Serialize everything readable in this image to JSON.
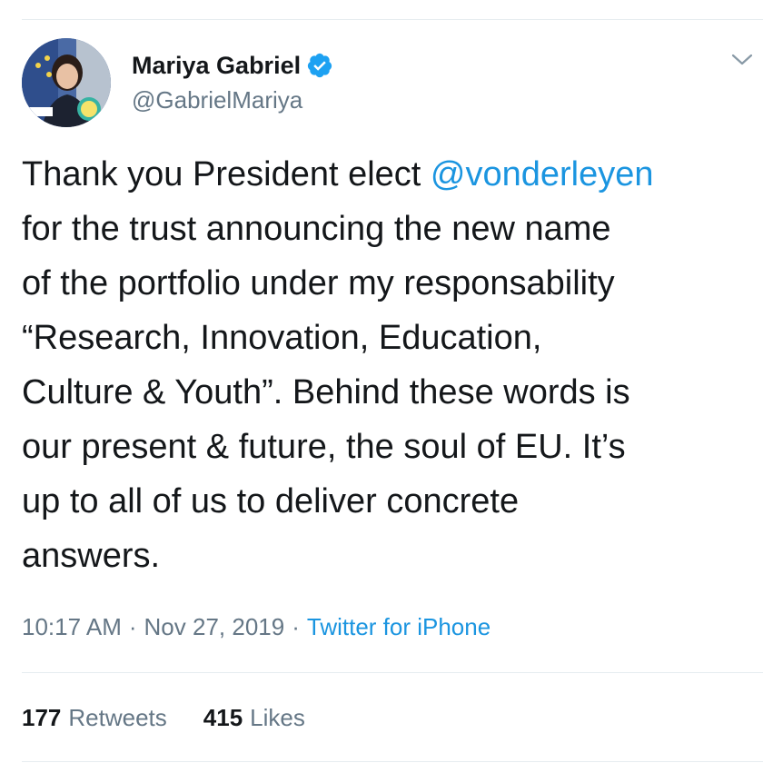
{
  "author": {
    "name": "Mariya Gabriel",
    "handle": "@GabrielMariya",
    "verified": true
  },
  "tweet": {
    "text_before": "Thank you President elect ",
    "mention": "@vonderleyen",
    "text_after": "\nfor the trust announcing the new name\nof the portfolio under my responsability\n“Research, Innovation, Education,\nCulture & Youth”. Behind these words is\nour present & future, the soul of EU. It’s\nup to all of us to deliver concrete\nanswers."
  },
  "meta": {
    "time": "10:17 AM",
    "date": "Nov 27, 2019",
    "separator": "·",
    "source": "Twitter for iPhone"
  },
  "stats": {
    "retweets_count": "177",
    "retweets_label": "Retweets",
    "likes_count": "415",
    "likes_label": "Likes"
  },
  "colors": {
    "link": "#1b95e0",
    "secondary_text": "#657786",
    "divider": "#e6ecf0"
  },
  "icons": {
    "verified": "verified-badge-icon",
    "caret": "chevron-down-icon"
  }
}
